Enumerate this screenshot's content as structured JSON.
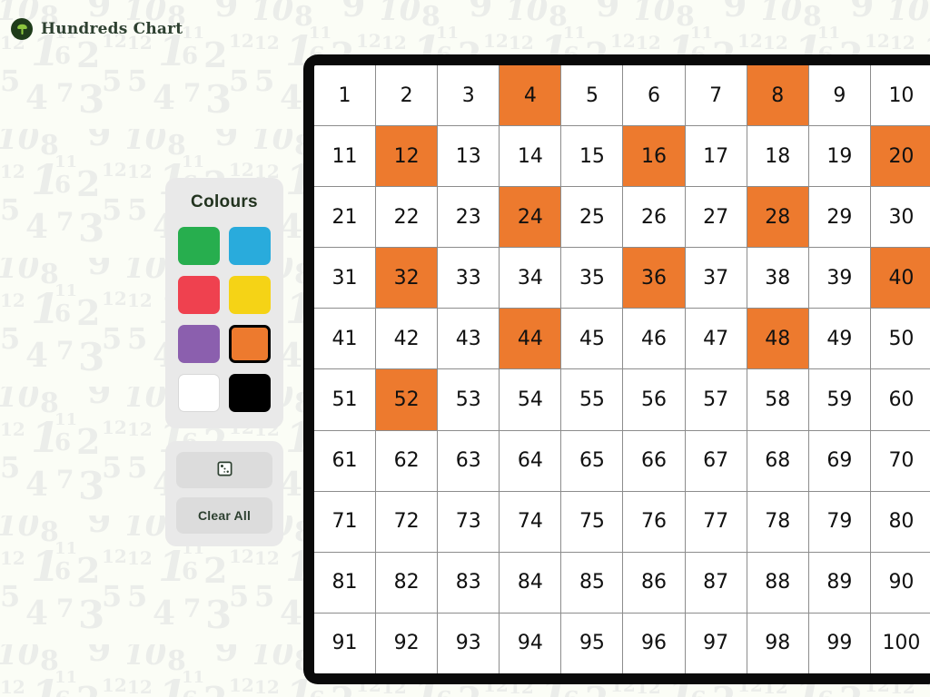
{
  "header": {
    "title": "Hundreds Chart",
    "logo_icon": "mushroom-logo-icon",
    "logo_bg": "#1f3c1a",
    "logo_fg": "#8cc63f",
    "title_color": "#2d4030"
  },
  "background": {
    "base_color": "#fbfdf6",
    "pattern_color": "#eceeea",
    "pattern_numbers": [
      "10",
      "8",
      "9",
      "11",
      "12",
      "1",
      "6",
      "2",
      "5",
      "4",
      "7",
      "3"
    ]
  },
  "colours_panel": {
    "heading": "Colours",
    "panel_bg": "#e9e9e9",
    "selected_colour": "#ED7A2E",
    "swatches": [
      {
        "name": "green",
        "hex": "#27AE4E",
        "selected": false
      },
      {
        "name": "blue",
        "hex": "#29ABDC",
        "selected": false
      },
      {
        "name": "red",
        "hex": "#EF414F",
        "selected": false
      },
      {
        "name": "yellow",
        "hex": "#F5D316",
        "selected": false
      },
      {
        "name": "purple",
        "hex": "#8B5FAE",
        "selected": false
      },
      {
        "name": "orange",
        "hex": "#ED7A2E",
        "selected": true
      },
      {
        "name": "white",
        "hex": "#FFFFFF",
        "selected": false
      },
      {
        "name": "black",
        "hex": "#000000",
        "selected": false
      }
    ]
  },
  "actions": {
    "dice_icon": "dice-icon",
    "dice_label": "",
    "clear_all_label": "Clear All"
  },
  "chart_data": {
    "type": "table",
    "title": "Hundreds Chart",
    "rows": 10,
    "columns": 10,
    "min": 1,
    "max": 100,
    "cells": [
      [
        1,
        2,
        3,
        4,
        5,
        6,
        7,
        8,
        9,
        10
      ],
      [
        11,
        12,
        13,
        14,
        15,
        16,
        17,
        18,
        19,
        20
      ],
      [
        21,
        22,
        23,
        24,
        25,
        26,
        27,
        28,
        29,
        30
      ],
      [
        31,
        32,
        33,
        34,
        35,
        36,
        37,
        38,
        39,
        40
      ],
      [
        41,
        42,
        43,
        44,
        45,
        46,
        47,
        48,
        49,
        50
      ],
      [
        51,
        52,
        53,
        54,
        55,
        56,
        57,
        58,
        59,
        60
      ],
      [
        61,
        62,
        63,
        64,
        65,
        66,
        67,
        68,
        69,
        70
      ],
      [
        71,
        72,
        73,
        74,
        75,
        76,
        77,
        78,
        79,
        80
      ],
      [
        81,
        82,
        83,
        84,
        85,
        86,
        87,
        88,
        89,
        90
      ],
      [
        91,
        92,
        93,
        94,
        95,
        96,
        97,
        98,
        99,
        100
      ]
    ],
    "highlighted": [
      4,
      8,
      12,
      16,
      20,
      24,
      28,
      32,
      36,
      40,
      44,
      48,
      52
    ],
    "highlight_colour": "#ED7A2E",
    "cell_bg": "#FFFFFF",
    "cell_text_colour": "#111111",
    "grid_line_colour": "#8C8C8C",
    "frame_colour": "#0A0A0A"
  }
}
